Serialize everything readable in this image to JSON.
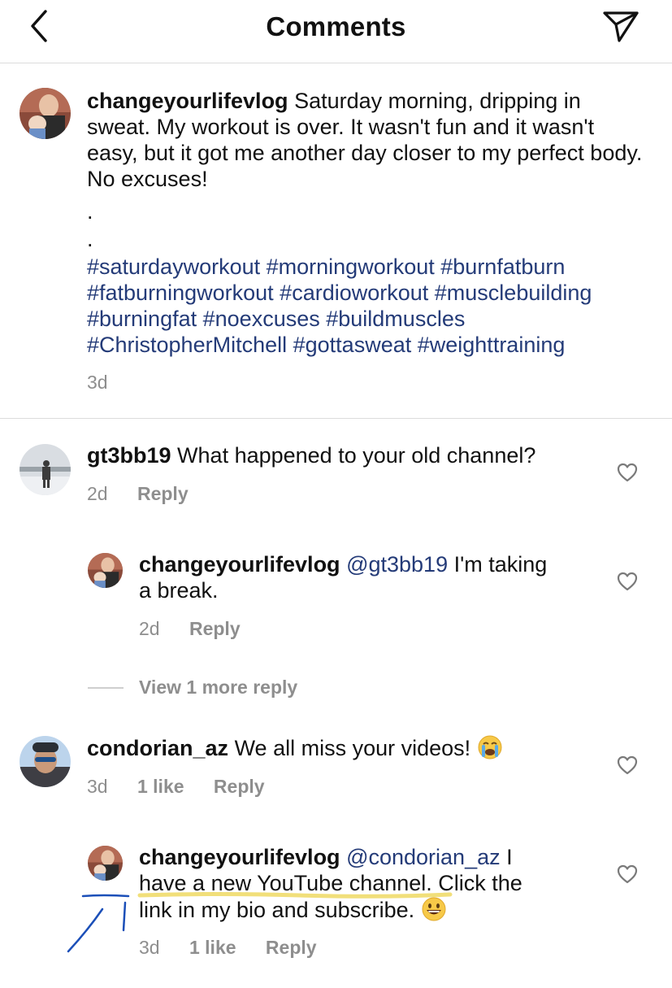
{
  "header": {
    "title": "Comments",
    "back_icon": "chevron-left-icon",
    "share_icon": "paper-plane-icon"
  },
  "post": {
    "username": "changeyourlifevlog",
    "caption": "Saturday morning, dripping in sweat. My workout is over. It wasn't fun and it wasn't easy, but it got me another day closer to my perfect body. No excuses!",
    "dot1": ".",
    "dot2": ".",
    "hashtags": [
      "#saturdayworkout",
      "#morningworkout",
      "#burnfatburn",
      "#fatburningworkout",
      "#cardioworkout",
      "#musclebuilding",
      "#burningfat",
      "#noexcuses",
      "#buildmuscles",
      "#ChristopherMitchell",
      "#gottasweat",
      "#weighttraining"
    ],
    "time": "3d"
  },
  "comments": [
    {
      "username": "gt3bb19",
      "text": "What happened to your old channel?",
      "time": "2d",
      "reply": "Reply"
    },
    {
      "username": "changeyourlifevlog",
      "mention": "@gt3bb19",
      "text_line1": "I'm taking",
      "text_line2": "a break.",
      "time": "2d",
      "reply": "Reply"
    },
    {
      "view_more": "View 1 more reply"
    },
    {
      "username": "condorian_az",
      "text": "We all miss your videos!",
      "emoji": "crying-face",
      "time": "3d",
      "likes": "1 like",
      "reply": "Reply"
    },
    {
      "username": "changeyourlifevlog",
      "mention": "@condorian_az",
      "text_line1_end": "I",
      "text_line2": "have a new YouTube channel. Click the",
      "text_line3": "link in my bio and subscribe.",
      "emoji": "grinning-face",
      "time": "3d",
      "likes": "1 like",
      "reply": "Reply"
    }
  ],
  "colors": {
    "hashtag": "#243b78",
    "meta": "#8e8e8e",
    "highlight_underline": "#f1df7a",
    "annotation": "#1b4fb8"
  }
}
